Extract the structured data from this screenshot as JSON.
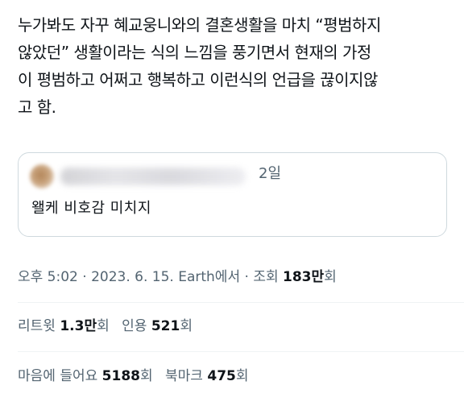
{
  "tweet": {
    "text_lines": [
      "누가봐도 자꾸 혜교웅니와의 결혼생활을 마치 “평범하지",
      "않았던” 생활이라는 식의 느낌을 풍기면서 현재의 가정",
      "이 평범하고 어쩌고 행복하고 이런식의 언급을 끊이지않",
      "고 함."
    ]
  },
  "quoted_tweet": {
    "time": "2일",
    "text": "왤케 비호감 미치지"
  },
  "meta": {
    "time": "오후 5:02",
    "separator1": " · ",
    "date": "2023. 6. 15.",
    "source": " Earth에서",
    "separator2": " · ",
    "views_label": "조회 ",
    "views_count": "183만",
    "views_unit": "회"
  },
  "stats": {
    "retweets_label": "리트윗 ",
    "retweets_count": "1.3만",
    "retweets_unit": "회",
    "quotes_label": "인용 ",
    "quotes_count": "521",
    "quotes_unit": "회",
    "likes_label": "마음에 들어요 ",
    "likes_count": "5188",
    "likes_unit": "회",
    "bookmarks_label": "북마크 ",
    "bookmarks_count": "475",
    "bookmarks_unit": "회"
  }
}
